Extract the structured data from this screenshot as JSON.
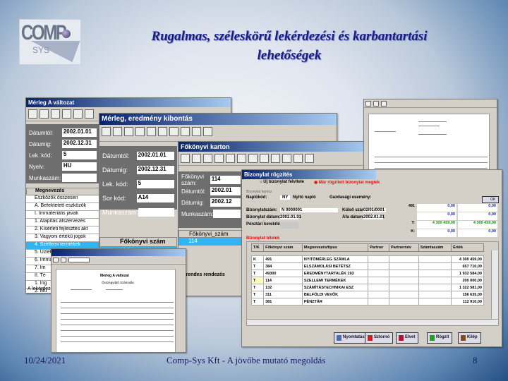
{
  "slide": {
    "title_line1": "Rugalmas, széleskörű  lekérdezési és karbantartási",
    "title_line2": "lehetőségek",
    "logo_text": "COMP",
    "logo_sub": "SYS",
    "date": "10/24/2021",
    "footer": "Comp-Sys Kft - A jövőbe mutató megoldás",
    "page": "8"
  },
  "win1": {
    "title": "Mérleg A változat",
    "fields": [
      {
        "label": "Dátumtól:",
        "value": "2002.01.01"
      },
      {
        "label": "Dátumig:",
        "value": "2002.12.31"
      },
      {
        "label": "Lek. kód:",
        "value": "5"
      },
      {
        "label": "Nyelv:",
        "value": "HU"
      },
      {
        "label": "Munkaszám:",
        "value": ""
      }
    ],
    "list_header": "Megnevezés",
    "list": [
      "Eszközök összesen",
      "A. Befektetett eszközök",
      "I. Immateriális javak",
      "1. Alapítás átszervezés",
      "2. Kísérleti fejlesztés akt",
      "3. Vagyoni értékű jogok",
      "4. Szellemi termékek",
      "5. Üzleti vagy cégérték",
      "6. Immateriális javakra a",
      "7. Im",
      "II. Té",
      "1. Ing",
      "2. Mű"
    ],
    "selected": 6,
    "status": "A lekérdez"
  },
  "win2": {
    "title": "Mérleg, eredmény kibontás",
    "fields": [
      {
        "label": "Dátumtól:",
        "value": "2002.01.01"
      },
      {
        "label": "Dátumig:",
        "value": "2002.12.31"
      },
      {
        "label": "Lek. kód:",
        "value": "5"
      },
      {
        "label": "Sor kód:",
        "value": "A14"
      },
      {
        "label": "Munkaszám:",
        "value": ""
      }
    ],
    "col": "Főkönyvi  szám",
    "row": "114"
  },
  "win3": {
    "title": "Főkönyvi karton",
    "fields": [
      {
        "label": "Főkönyvi  szám:",
        "value": "114"
      },
      {
        "label": "Dátumtól:",
        "value": "2002.01"
      },
      {
        "label": "Dátumig:",
        "value": "2002.12"
      },
      {
        "label": "Munkaszám:",
        "value": ""
      }
    ],
    "col": "Főkönyvi_szám",
    "row": "114",
    "bottom": "Időrendes rendezés"
  },
  "win4": {
    "title": "Bizonylat rögzítés",
    "radio1": "Új bizonylat felvitele",
    "radio2": "Már rögzített bizonylat megtek",
    "group": "Bizonylat fejrész",
    "naplokod_label": "Naplókód:",
    "naplokod": "NY",
    "naplo_name": "Nyitó napló",
    "gazd_label": "Gazdasági esemény:",
    "biz_label": "Bizonylatszám:",
    "biz": "N 0000001",
    "datum_label": "Bizonylat dátum:",
    "datum": "2002.01.01",
    "kulso_label": "Külső szám:",
    "kulso": "02/01/0001",
    "afa_label": "Áfa dátum:",
    "afa": "2002.01.01",
    "penz_label": "Pénztári kerekítés:",
    "sums": [
      {
        "k": "491",
        "a": "0,00",
        "b": "0,00"
      },
      {
        "k": "",
        "a": "0,00",
        "b": "0,00"
      },
      {
        "k": "T:",
        "a": "4 300 459,00",
        "b": "4 300 459,00"
      },
      {
        "k": "K:",
        "a": "0,00",
        "b": "0,00"
      }
    ],
    "items_label": "Bizonylat tételek",
    "columns": [
      "T/K",
      "Főkönyvi szám",
      "Megnevezés/típus",
      "Partner",
      "Partnernév",
      "Számlaszám",
      "Érték"
    ],
    "rows": [
      [
        "K",
        "491",
        "NYITÓMÉRLEG SZÁMLA",
        "",
        "",
        "",
        "4 300 459,00"
      ],
      [
        "T",
        "384",
        "ELSZÁMOLÁSI BETÉTSZ",
        "",
        "",
        "",
        "657 710,00"
      ],
      [
        "T",
        "49300",
        "EREDMÉNYTARTALÉK 193",
        "",
        "",
        "",
        "1 932 584,00"
      ],
      [
        "T",
        "114",
        "SZELLEMI TERMÉKEK",
        "",
        "",
        "",
        "200 000,00"
      ],
      [
        "T",
        "132",
        "SZÁMÍTÁSTECHNIKAI ESZ",
        "",
        "",
        "",
        "1 322 581,00"
      ],
      [
        "T",
        "311",
        "BELFÖLDI VEVŐK",
        "",
        "",
        "",
        "156 635,00"
      ],
      [
        "T",
        "381",
        "PÉNZTÁR",
        "",
        "",
        "",
        "112 910,00"
      ]
    ],
    "buttons": [
      "Nyomtatás",
      "Sztornó",
      "Elvet",
      "Rögzít",
      "Kilép"
    ],
    "colors": {
      "Nyomtatás": "#4a6fb0",
      "Sztornó": "#d02020",
      "Elvet": "#c01030",
      "Rögzít": "#20a020",
      "Kilép": "#8a4a10"
    },
    "ok": "OK"
  },
  "report1": {
    "title": "Mérleg A változat",
    "sub": "Összegyűjtő Számolás"
  }
}
